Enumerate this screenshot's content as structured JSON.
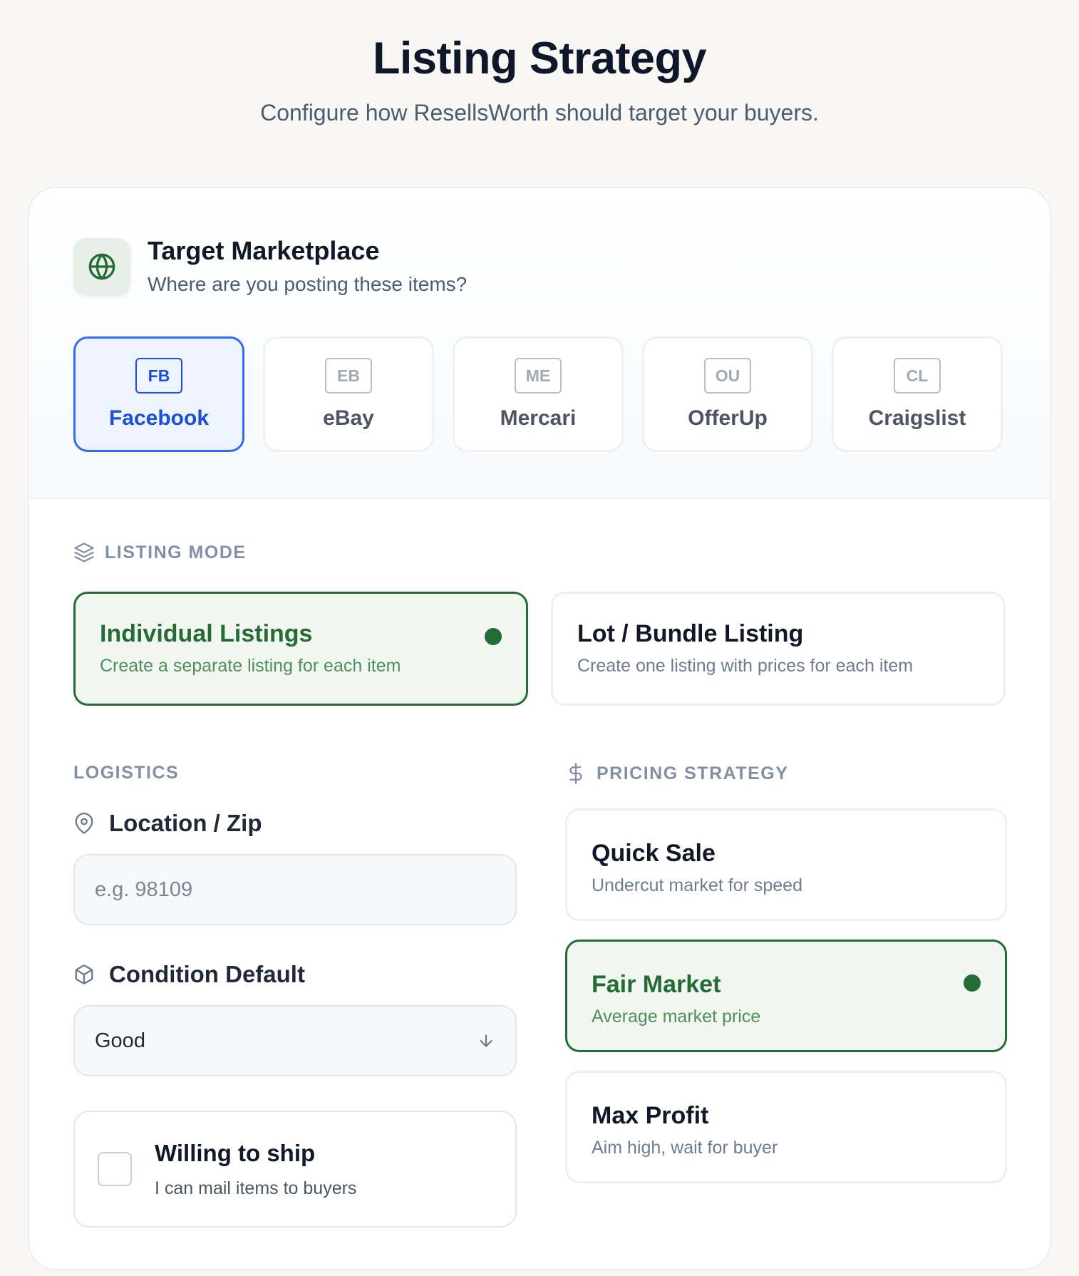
{
  "header": {
    "title": "Listing Strategy",
    "subtitle": "Configure how ResellsWorth should target your buyers."
  },
  "marketplace": {
    "title": "Target Marketplace",
    "subtitle": "Where are you posting these items?",
    "icon": "globe-icon",
    "options": [
      {
        "code": "FB",
        "name": "Facebook",
        "selected": true
      },
      {
        "code": "EB",
        "name": "eBay",
        "selected": false
      },
      {
        "code": "ME",
        "name": "Mercari",
        "selected": false
      },
      {
        "code": "OU",
        "name": "OfferUp",
        "selected": false
      },
      {
        "code": "CL",
        "name": "Craigslist",
        "selected": false
      }
    ]
  },
  "listing_mode": {
    "label": "LISTING MODE",
    "options": [
      {
        "title": "Individual Listings",
        "description": "Create a separate listing for each item",
        "selected": true
      },
      {
        "title": "Lot / Bundle Listing",
        "description": "Create one listing with prices for each item",
        "selected": false
      }
    ]
  },
  "logistics": {
    "label": "LOGISTICS",
    "location": {
      "label": "Location / Zip",
      "placeholder": "e.g. 98109",
      "value": ""
    },
    "condition": {
      "label": "Condition Default",
      "value": "Good"
    },
    "ship": {
      "title": "Willing to ship",
      "description": "I can mail items to buyers",
      "checked": false
    }
  },
  "pricing": {
    "label": "PRICING STRATEGY",
    "options": [
      {
        "title": "Quick Sale",
        "description": "Undercut market for speed",
        "selected": false
      },
      {
        "title": "Fair Market",
        "description": "Average market price",
        "selected": true
      },
      {
        "title": "Max Profit",
        "description": "Aim high, wait for buyer",
        "selected": false
      }
    ]
  },
  "colors": {
    "accent_blue": "#1d4ed8",
    "accent_green": "#256b34",
    "background": "#f8f7f3"
  }
}
